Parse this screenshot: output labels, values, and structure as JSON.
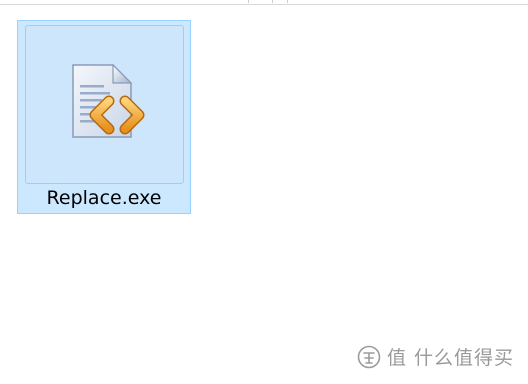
{
  "file": {
    "name": "Replace.exe",
    "icon": "code-document-icon",
    "selected": true
  },
  "watermark": {
    "text": "值 什么值得买"
  },
  "colors": {
    "selection_fill": "#cce8ff",
    "selection_border": "#99d1ff",
    "icon_accent": "#f5a623"
  }
}
